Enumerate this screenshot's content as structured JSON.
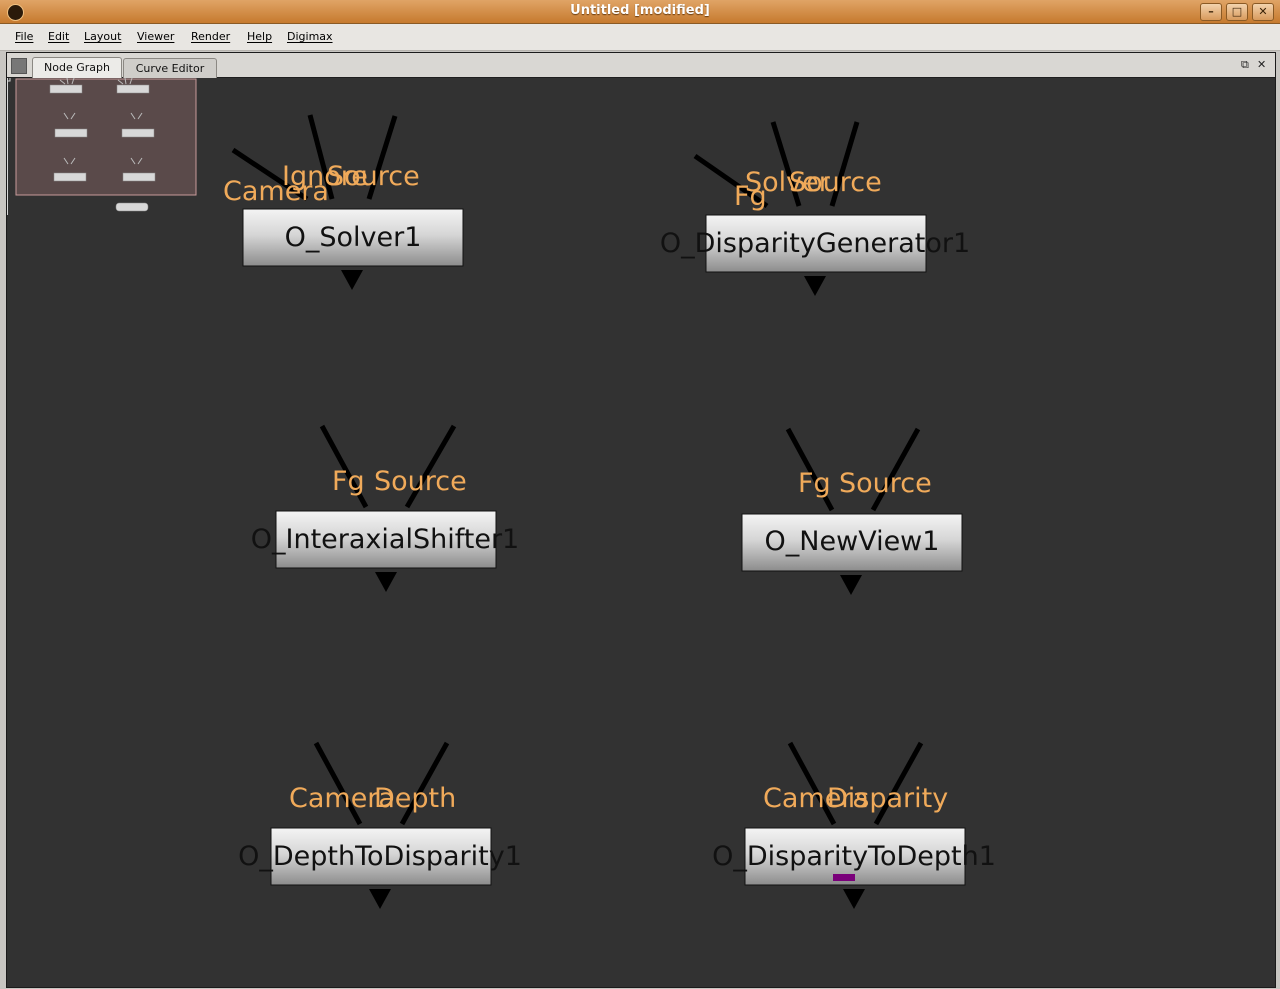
{
  "window": {
    "title": "Untitled [modified]",
    "minimize": "–",
    "maximize": "□",
    "close": "✕"
  },
  "menubar": {
    "items": [
      "File",
      "Edit",
      "Layout",
      "Viewer",
      "Render",
      "Help",
      "Digimax"
    ]
  },
  "tabs": [
    {
      "label": "Node Graph",
      "active": true
    },
    {
      "label": "Curve Editor",
      "active": false
    }
  ],
  "panel_buttons": {
    "float": "⧉",
    "close": "✕"
  },
  "colors": {
    "node_fill_top": "#f2f2f2",
    "node_fill_bottom": "#8c8c8c",
    "port_label": "#f0aa5a",
    "graph_bg": "#323232",
    "minimap_bg": "#5a4a4a",
    "selection_marker": "#7a007a"
  },
  "nodes": [
    {
      "name": "O_Solver1",
      "inputs": [
        "Camera",
        "Ignore",
        "Source"
      ]
    },
    {
      "name": "O_DisparityGenerator1",
      "inputs": [
        "Fg",
        "Solver",
        "Source"
      ]
    },
    {
      "name": "O_InteraxialShifter1",
      "inputs": [
        "Fg",
        "Source"
      ]
    },
    {
      "name": "O_NewView1",
      "inputs": [
        "Fg",
        "Source"
      ]
    },
    {
      "name": "O_DepthToDisparity1",
      "inputs": [
        "Camera",
        "Depth"
      ]
    },
    {
      "name": "O_DisparityToDepth1",
      "inputs": [
        "Camera",
        "Disparity"
      ]
    }
  ]
}
